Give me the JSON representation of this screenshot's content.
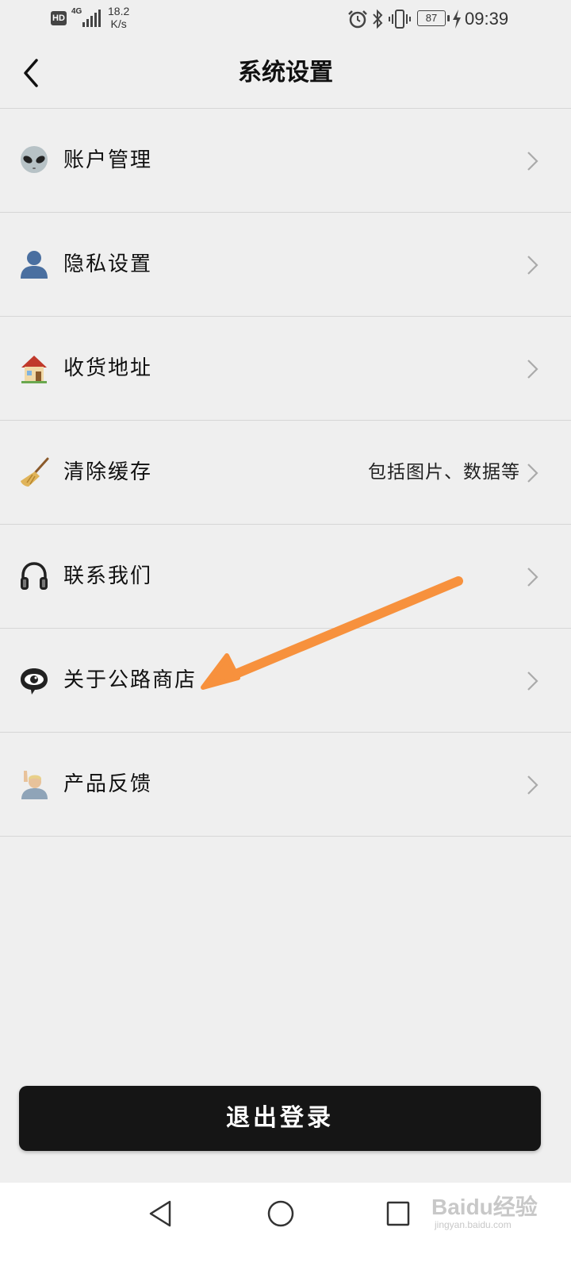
{
  "status_bar": {
    "hd": "HD",
    "network": "4G",
    "speed_value": "18.2",
    "speed_unit": "K/s",
    "battery": "87",
    "time": "09:39"
  },
  "header": {
    "title": "系统设置"
  },
  "menu": [
    {
      "label": "账户管理",
      "hint": "",
      "icon": "alien-icon"
    },
    {
      "label": "隐私设置",
      "hint": "",
      "icon": "person-silhouette-icon"
    },
    {
      "label": "收货地址",
      "hint": "",
      "icon": "house-icon"
    },
    {
      "label": "清除缓存",
      "hint": "包括图片、数据等",
      "icon": "broom-icon"
    },
    {
      "label": "联系我们",
      "hint": "",
      "icon": "headphones-icon"
    },
    {
      "label": "关于公路商店",
      "hint": "",
      "icon": "eye-speech-bubble-icon"
    },
    {
      "label": "产品反馈",
      "hint": "",
      "icon": "raising-hand-icon"
    }
  ],
  "logout": {
    "label": "退出登录"
  },
  "watermark": {
    "main": "Baidu经验",
    "sub": "jingyan.baidu.com"
  },
  "colors": {
    "background": "#efefef",
    "button": "#151515",
    "annotation_arrow": "#f7913d"
  }
}
